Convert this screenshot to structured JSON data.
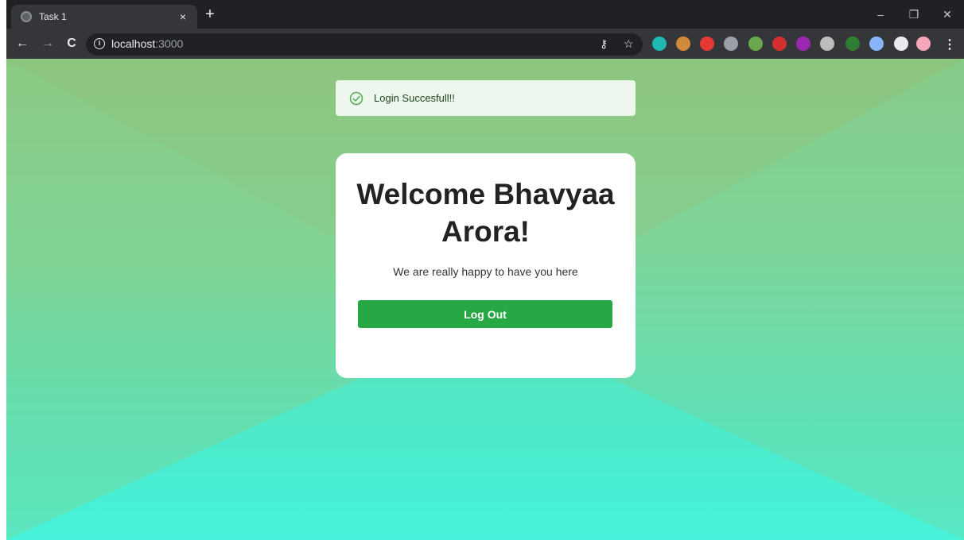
{
  "browser": {
    "tab": {
      "title": "Task 1",
      "close_label": "×"
    },
    "new_tab_label": "+",
    "window_controls": {
      "minimize": "–",
      "restore": "❐",
      "close": "✕"
    },
    "nav": {
      "back": "←",
      "forward": "→",
      "reload": "C"
    },
    "url": {
      "host": "localhost",
      "port": ":3000"
    },
    "omnibox_icons": [
      "key-icon",
      "star-icon"
    ],
    "extensions": [
      {
        "name": "m-extension-icon",
        "color": "#1fb8b3"
      },
      {
        "name": "glasses-extension-icon",
        "color": "#d08a3a"
      },
      {
        "name": "hand-stop-extension-icon",
        "color": "#e53935"
      },
      {
        "name": "bottle-extension-icon",
        "color": "#9aa0a6"
      },
      {
        "name": "hammer-extension-icon",
        "color": "#6aa84f"
      },
      {
        "name": "camera-extension-icon",
        "color": "#d32f2f"
      },
      {
        "name": "purple-face-extension-icon",
        "color": "#9c27b0"
      },
      {
        "name": "target-extension-icon",
        "color": "#bdbdbd"
      },
      {
        "name": "timer-extension-icon",
        "color": "#2e7d32"
      },
      {
        "name": "moon-extension-icon",
        "color": "#8ab4f8"
      },
      {
        "name": "puzzle-extension-icon",
        "color": "#e8eaed"
      },
      {
        "name": "profile-avatar-icon",
        "color": "#f4a7b9"
      }
    ],
    "menu_label": "⋮"
  },
  "toast": {
    "message": "Login Succesfull!!",
    "accent": "#4caf50"
  },
  "card": {
    "title": "Welcome Bhavyaa Arora!",
    "subtitle": "We are really happy to have you here",
    "button_label": "Log Out",
    "button_color": "#28a745"
  }
}
